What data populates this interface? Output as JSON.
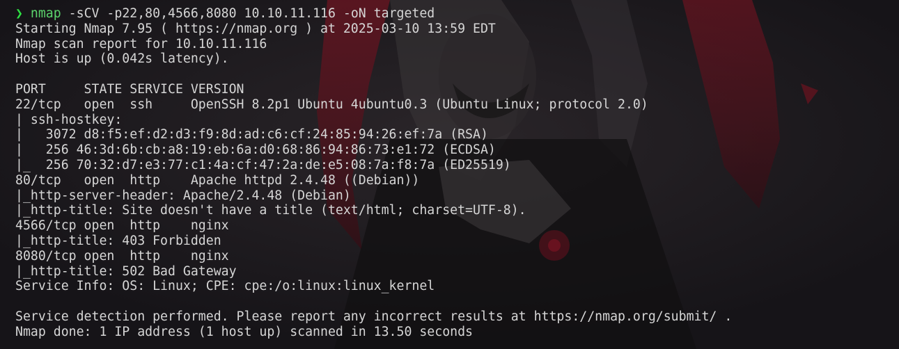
{
  "theme": {
    "background": "#161418",
    "text_color": "#d6d6d6",
    "prompt_arrow_color": "#2ee043",
    "command_color": "#5bd46c",
    "wallpaper_accent": "#7a1020"
  },
  "prompt": {
    "arrow": "❯",
    "command": "nmap",
    "arguments": "-sCV -p22,80,4566,8080 10.10.11.116 -oN targeted"
  },
  "output_lines": [
    "Starting Nmap 7.95 ( https://nmap.org ) at 2025-03-10 13:59 EDT",
    "Nmap scan report for 10.10.11.116",
    "Host is up (0.042s latency).",
    "",
    "PORT     STATE SERVICE VERSION",
    "22/tcp   open  ssh     OpenSSH 8.2p1 Ubuntu 4ubuntu0.3 (Ubuntu Linux; protocol 2.0)",
    "| ssh-hostkey:",
    "|   3072 d8:f5:ef:d2:d3:f9:8d:ad:c6:cf:24:85:94:26:ef:7a (RSA)",
    "|   256 46:3d:6b:cb:a8:19:eb:6a:d0:68:86:94:86:73:e1:72 (ECDSA)",
    "|_  256 70:32:d7:e3:77:c1:4a:cf:47:2a:de:e5:08:7a:f8:7a (ED25519)",
    "80/tcp   open  http    Apache httpd 2.4.48 ((Debian))",
    "|_http-server-header: Apache/2.4.48 (Debian)",
    "|_http-title: Site doesn't have a title (text/html; charset=UTF-8).",
    "4566/tcp open  http    nginx",
    "|_http-title: 403 Forbidden",
    "8080/tcp open  http    nginx",
    "|_http-title: 502 Bad Gateway",
    "Service Info: OS: Linux; CPE: cpe:/o:linux:linux_kernel",
    "",
    "Service detection performed. Please report any incorrect results at https://nmap.org/submit/ .",
    "Nmap done: 1 IP address (1 host up) scanned in 13.50 seconds"
  ]
}
